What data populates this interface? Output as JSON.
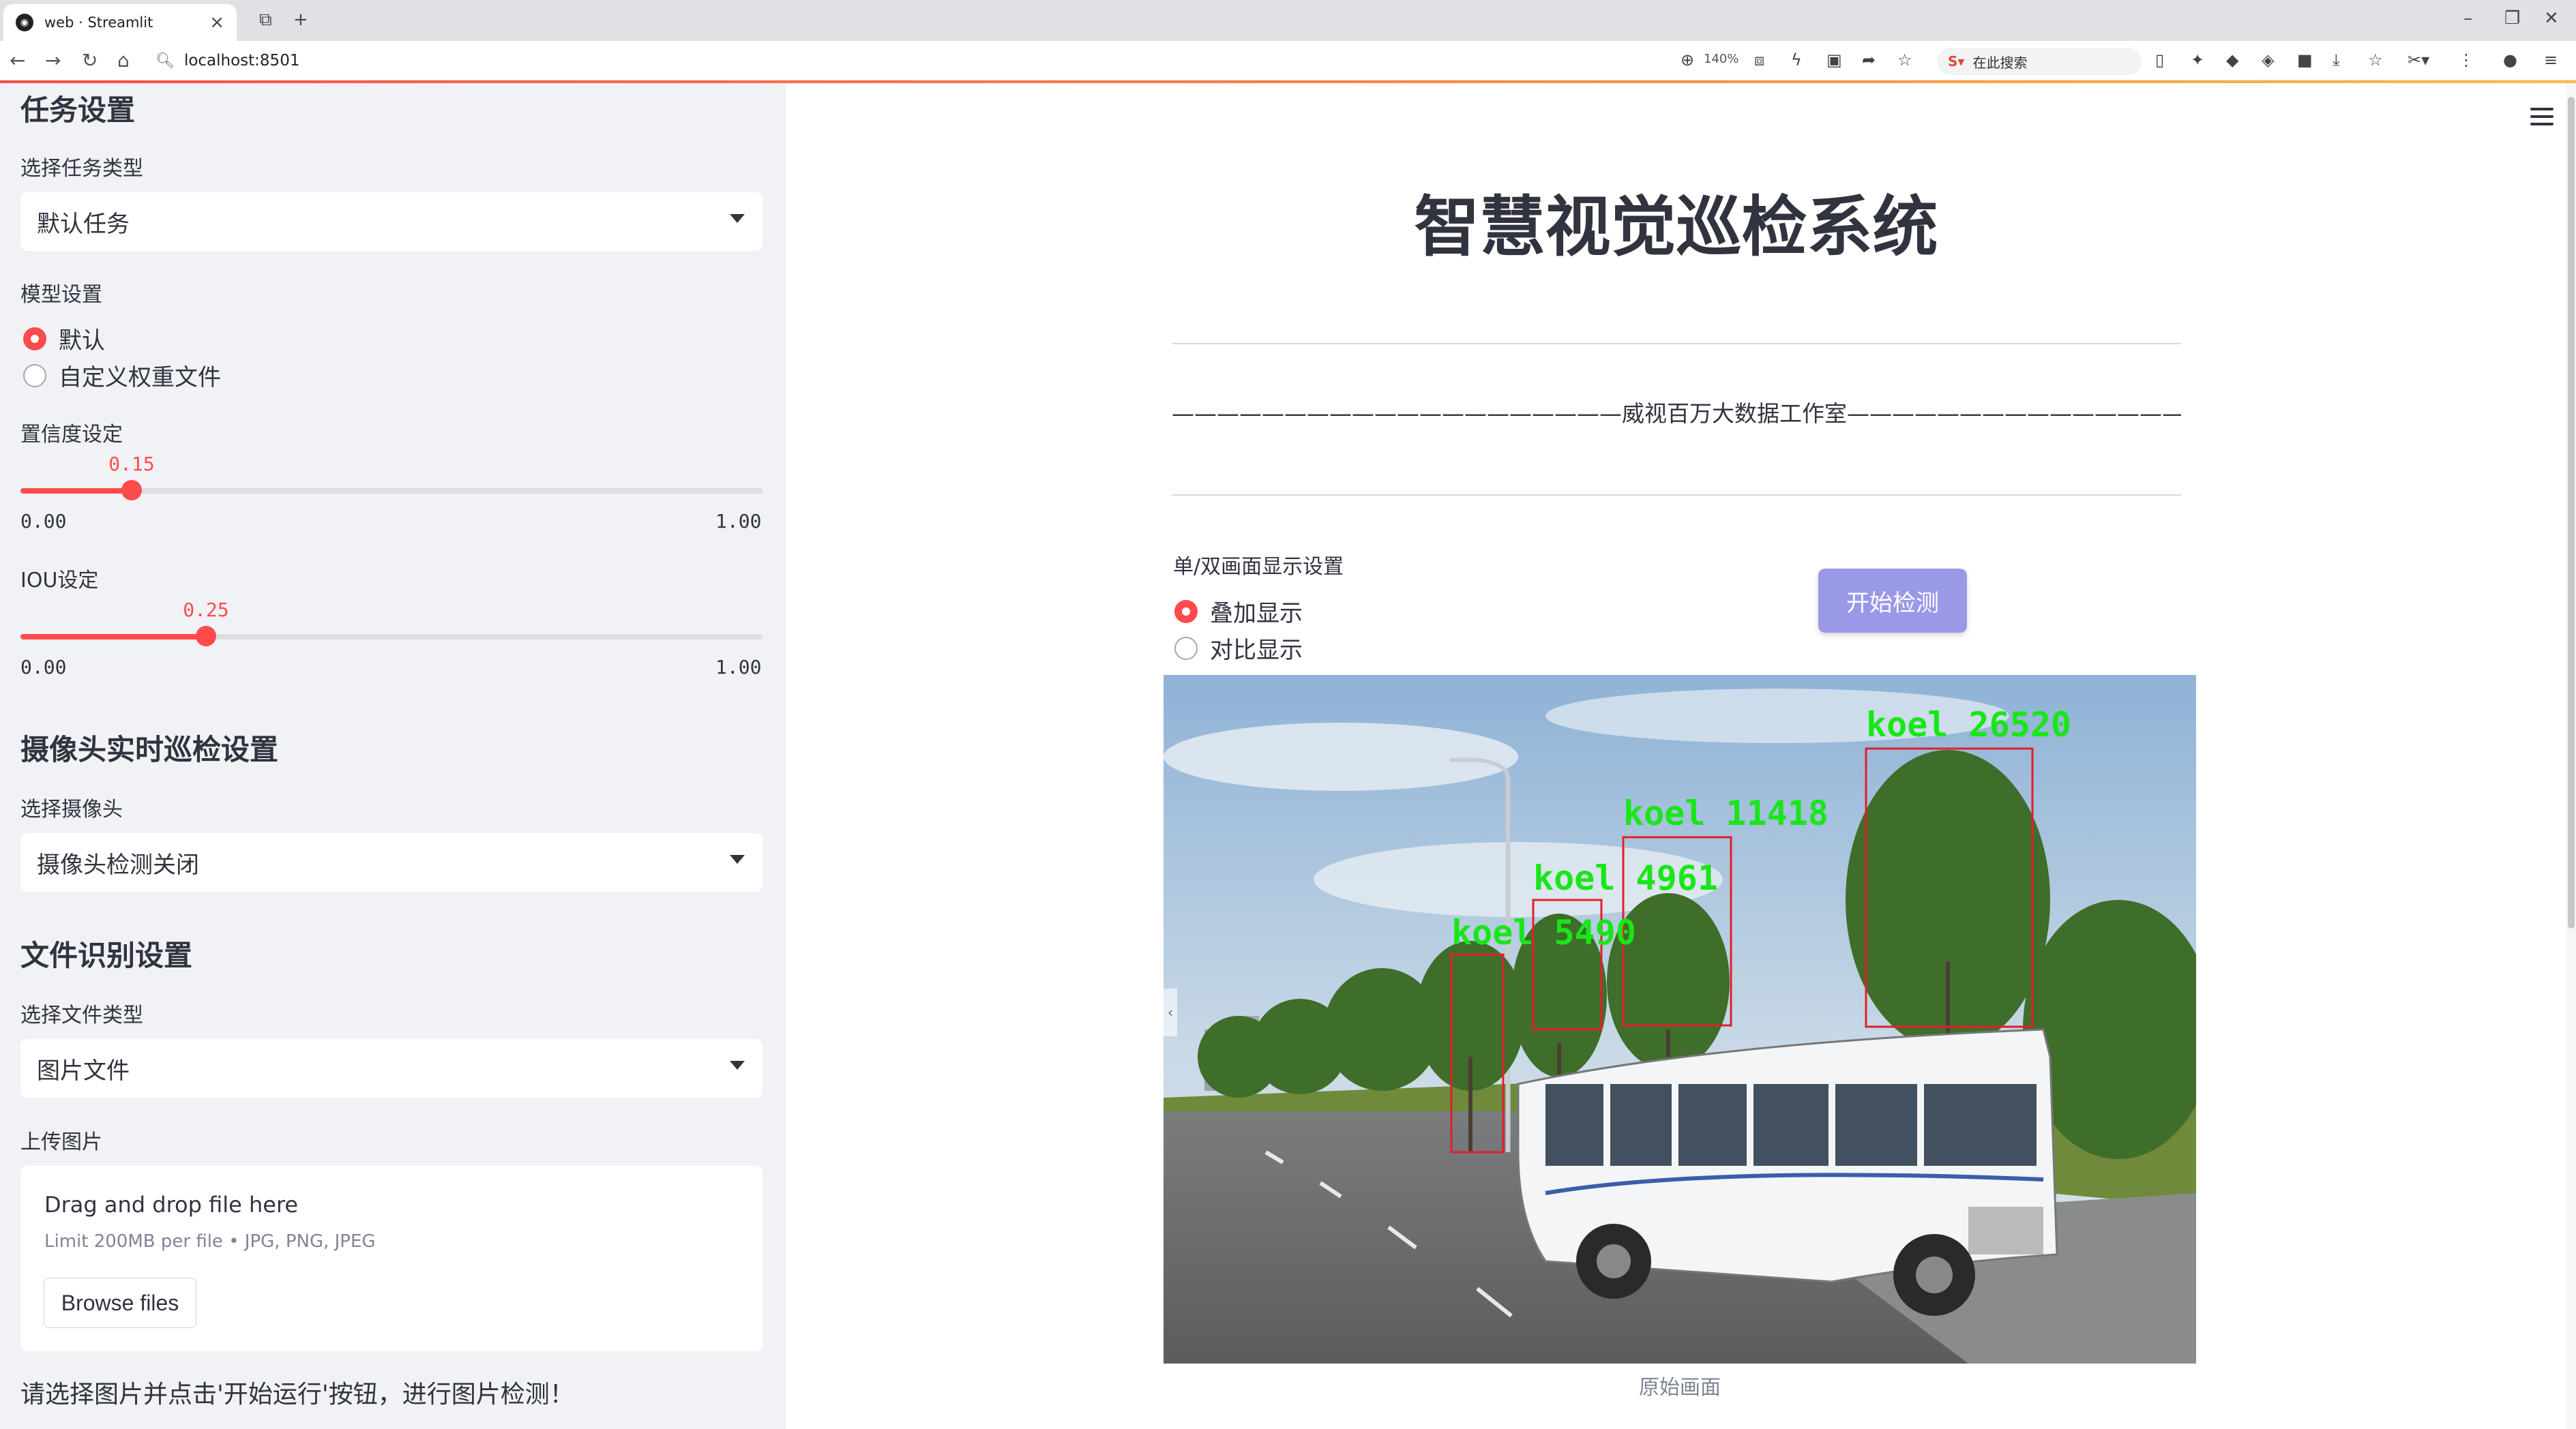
{
  "browser": {
    "tab_title": "web · Streamlit",
    "url": "localhost:8501",
    "zoom": "140%",
    "search_placeholder": "在此搜索"
  },
  "sidebar": {
    "task_heading": "任务设置",
    "task_type_label": "选择任务类型",
    "task_type_value": "默认任务",
    "model_label": "模型设置",
    "model_options": [
      "默认",
      "自定义权重文件"
    ],
    "model_selected": 0,
    "confidence": {
      "label": "置信度设定",
      "value": 0.15,
      "value_text": "0.15",
      "min": "0.00",
      "max": "1.00"
    },
    "iou": {
      "label": "IOU设定",
      "value": 0.25,
      "value_text": "0.25",
      "min": "0.00",
      "max": "1.00"
    },
    "camera_heading": "摄像头实时巡检设置",
    "camera_label": "选择摄像头",
    "camera_value": "摄像头检测关闭",
    "file_heading": "文件识别设置",
    "file_type_label": "选择文件类型",
    "file_type_value": "图片文件",
    "upload_label": "上传图片",
    "upload_title": "Drag and drop file here",
    "upload_limit": "Limit 200MB per file • JPG, PNG, JPEG",
    "browse_label": "Browse files",
    "hint": "请选择图片并点击'开始运行'按钮，进行图片检测！"
  },
  "main": {
    "title": "智慧视觉巡检系统",
    "studio_line": "————————————————————威视百万大数据工作室——————————————————————",
    "display_label": "单/双画面显示设置",
    "display_options": [
      "叠加显示",
      "对比显示"
    ],
    "display_selected": 0,
    "start_button": "开始检测",
    "caption": "原始画面",
    "detections": [
      {
        "label": "koel 26520"
      },
      {
        "label": "koel 11418"
      },
      {
        "label": "koel 4961"
      },
      {
        "label": "koel 5490"
      }
    ]
  },
  "colors": {
    "accent": "#ff4b4b",
    "button": "#9a99e8",
    "detection_box": "#e0202a",
    "detection_text": "#19e619"
  }
}
